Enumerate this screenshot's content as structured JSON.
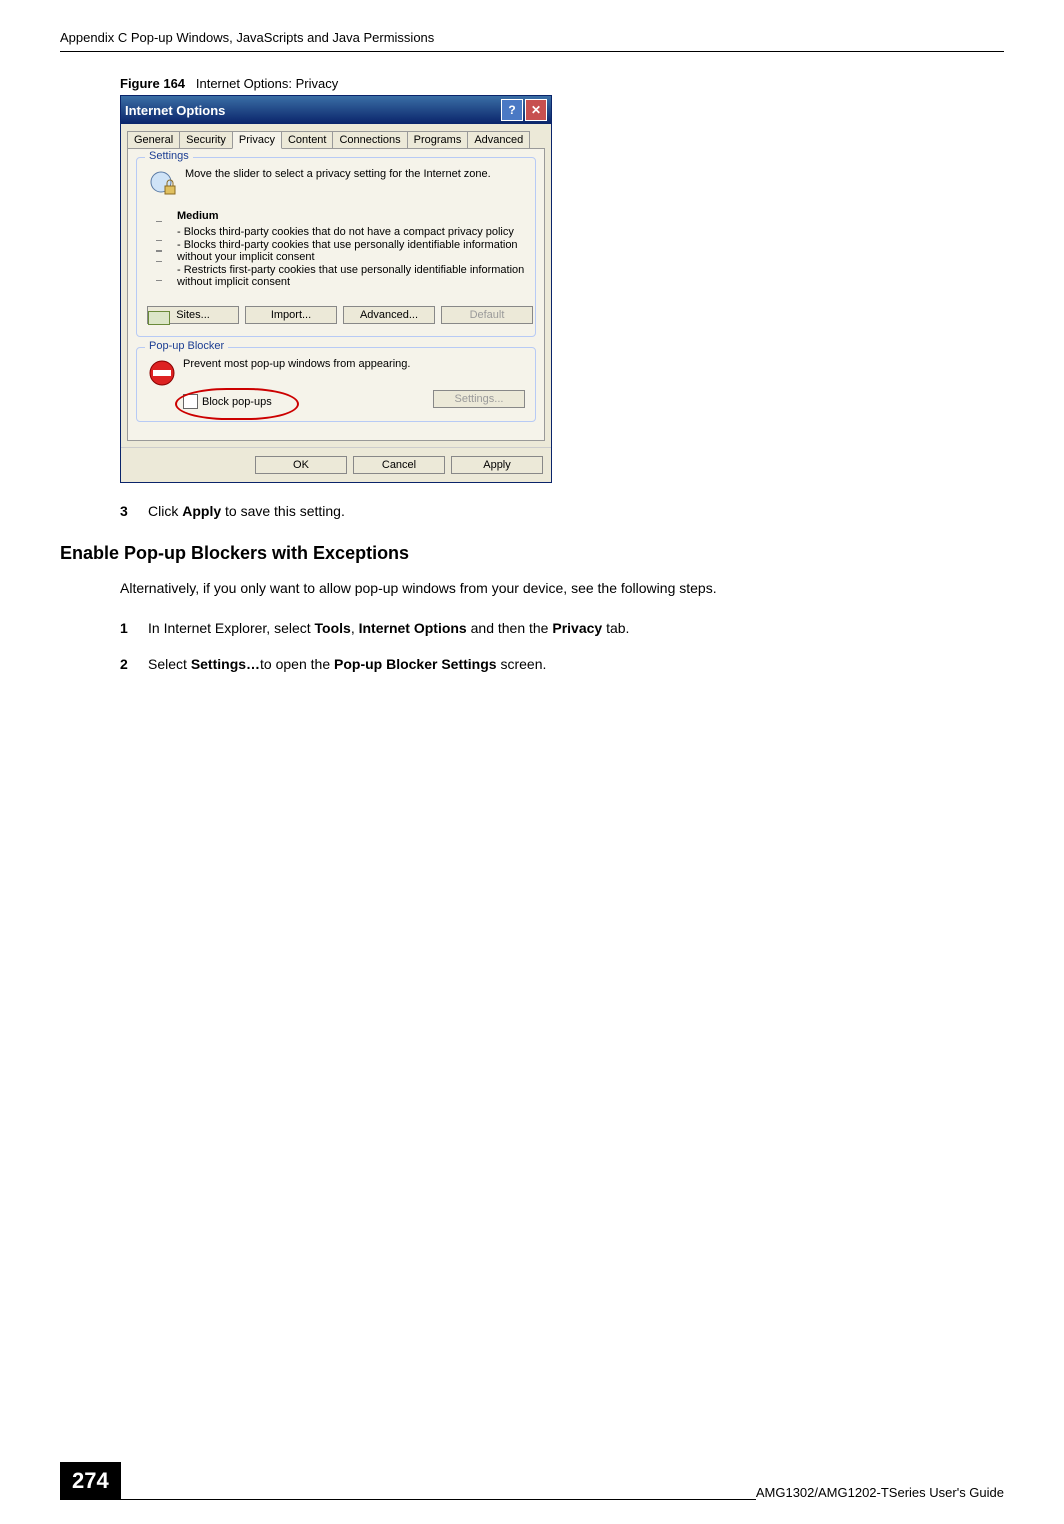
{
  "header": {
    "running": "Appendix C Pop-up Windows, JavaScripts and Java Permissions"
  },
  "figure": {
    "label": "Figure 164",
    "title": "Internet Options: Privacy"
  },
  "dialog": {
    "title": "Internet Options",
    "help_glyph": "?",
    "close_glyph": "✕",
    "tabs": [
      "General",
      "Security",
      "Privacy",
      "Content",
      "Connections",
      "Programs",
      "Advanced"
    ],
    "active_tab_index": 2,
    "settings": {
      "group_label": "Settings",
      "intro": "Move the slider to select a privacy setting for the Internet zone.",
      "level": "Medium",
      "bullets": [
        "- Blocks third-party cookies that do not have a compact privacy policy",
        "- Blocks third-party cookies that use personally identifiable information without your implicit consent",
        "- Restricts first-party cookies that use personally identifiable information without implicit consent"
      ],
      "buttons": {
        "sites": "Sites...",
        "import": "Import...",
        "advanced": "Advanced...",
        "default": "Default"
      }
    },
    "popup": {
      "group_label": "Pop-up Blocker",
      "intro": "Prevent most pop-up windows from appearing.",
      "checkbox_label": "Block pop-ups",
      "settings_btn": "Settings..."
    },
    "buttons": {
      "ok": "OK",
      "cancel": "Cancel",
      "apply": "Apply"
    }
  },
  "steps_after_fig": {
    "s3_num": "3",
    "s3_a": "Click ",
    "s3_b": "Apply",
    "s3_c": " to save this setting."
  },
  "section": {
    "title": "Enable Pop-up Blockers with Exceptions",
    "para": "Alternatively, if you only want to allow pop-up windows from your device, see the following steps."
  },
  "steps2": {
    "s1_num": "1",
    "s1_a": "In Internet Explorer, select ",
    "s1_b": "Tools",
    "s1_c": ", ",
    "s1_d": "Internet Options",
    "s1_e": " and then the ",
    "s1_f": "Privacy",
    "s1_g": " tab.",
    "s2_num": "2",
    "s2_a": "Select ",
    "s2_b": "Settings…",
    "s2_c": "to open the ",
    "s2_d": "Pop-up Blocker Settings",
    "s2_e": " screen."
  },
  "footer": {
    "page": "274",
    "guide": "AMG1302/AMG1202-TSeries User's Guide"
  }
}
